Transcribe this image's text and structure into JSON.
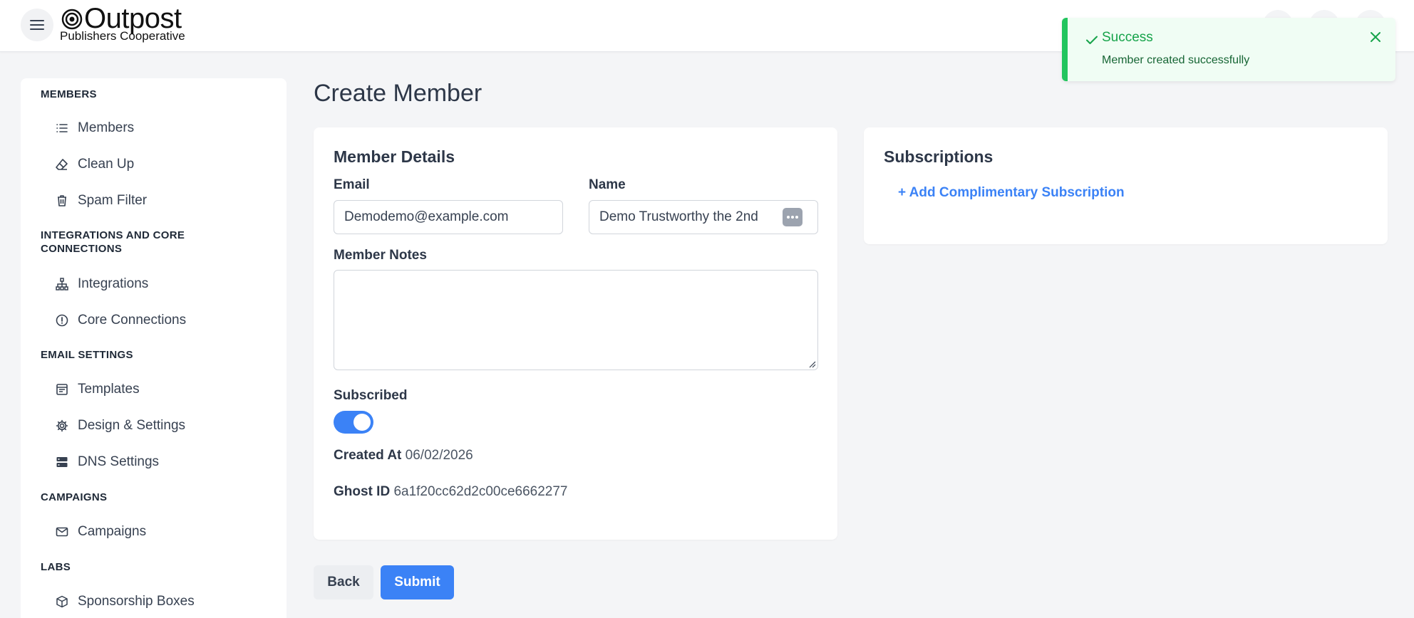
{
  "brand": {
    "name": "Outpost",
    "subtitle": "Publishers Cooperative"
  },
  "sidebar": {
    "sections": [
      {
        "title": "MEMBERS",
        "items": [
          {
            "label": "Members",
            "icon": "list-icon"
          },
          {
            "label": "Clean Up",
            "icon": "eraser-icon"
          },
          {
            "label": "Spam Filter",
            "icon": "trash-icon"
          }
        ]
      },
      {
        "title": "INTEGRATIONS AND CORE CONNECTIONS",
        "items": [
          {
            "label": "Integrations",
            "icon": "hierarchy-icon"
          },
          {
            "label": "Core Connections",
            "icon": "alert-circle-icon"
          }
        ]
      },
      {
        "title": "EMAIL SETTINGS",
        "items": [
          {
            "label": "Templates",
            "icon": "template-icon"
          },
          {
            "label": "Design & Settings",
            "icon": "gear-icon"
          },
          {
            "label": "DNS Settings",
            "icon": "server-icon"
          }
        ]
      },
      {
        "title": "CAMPAIGNS",
        "items": [
          {
            "label": "Campaigns",
            "icon": "mail-icon"
          }
        ]
      },
      {
        "title": "LABS",
        "items": [
          {
            "label": "Sponsorship Boxes",
            "icon": "box-icon"
          }
        ]
      }
    ]
  },
  "page": {
    "title": "Create Member"
  },
  "member_details": {
    "title": "Member Details",
    "email_label": "Email",
    "email_value": "Demodemo@example.com",
    "name_label": "Name",
    "name_value": "Demo Trustworthy the 2nd",
    "notes_label": "Member Notes",
    "notes_value": "",
    "subscribed_label": "Subscribed",
    "subscribed": true,
    "created_at_label": "Created At",
    "created_at_value": "06/02/2026",
    "ghost_id_label": "Ghost ID",
    "ghost_id_value": "6a1f20cc62d2c00ce6662277"
  },
  "subscriptions": {
    "title": "Subscriptions",
    "add_label": "+ Add Complimentary Subscription"
  },
  "actions": {
    "back_label": "Back",
    "submit_label": "Submit"
  },
  "toast": {
    "title": "Success",
    "message": "Member created successfully",
    "accent_color": "#22c55e"
  },
  "colors": {
    "primary": "#3b82f6",
    "background": "#f4f5f7"
  }
}
